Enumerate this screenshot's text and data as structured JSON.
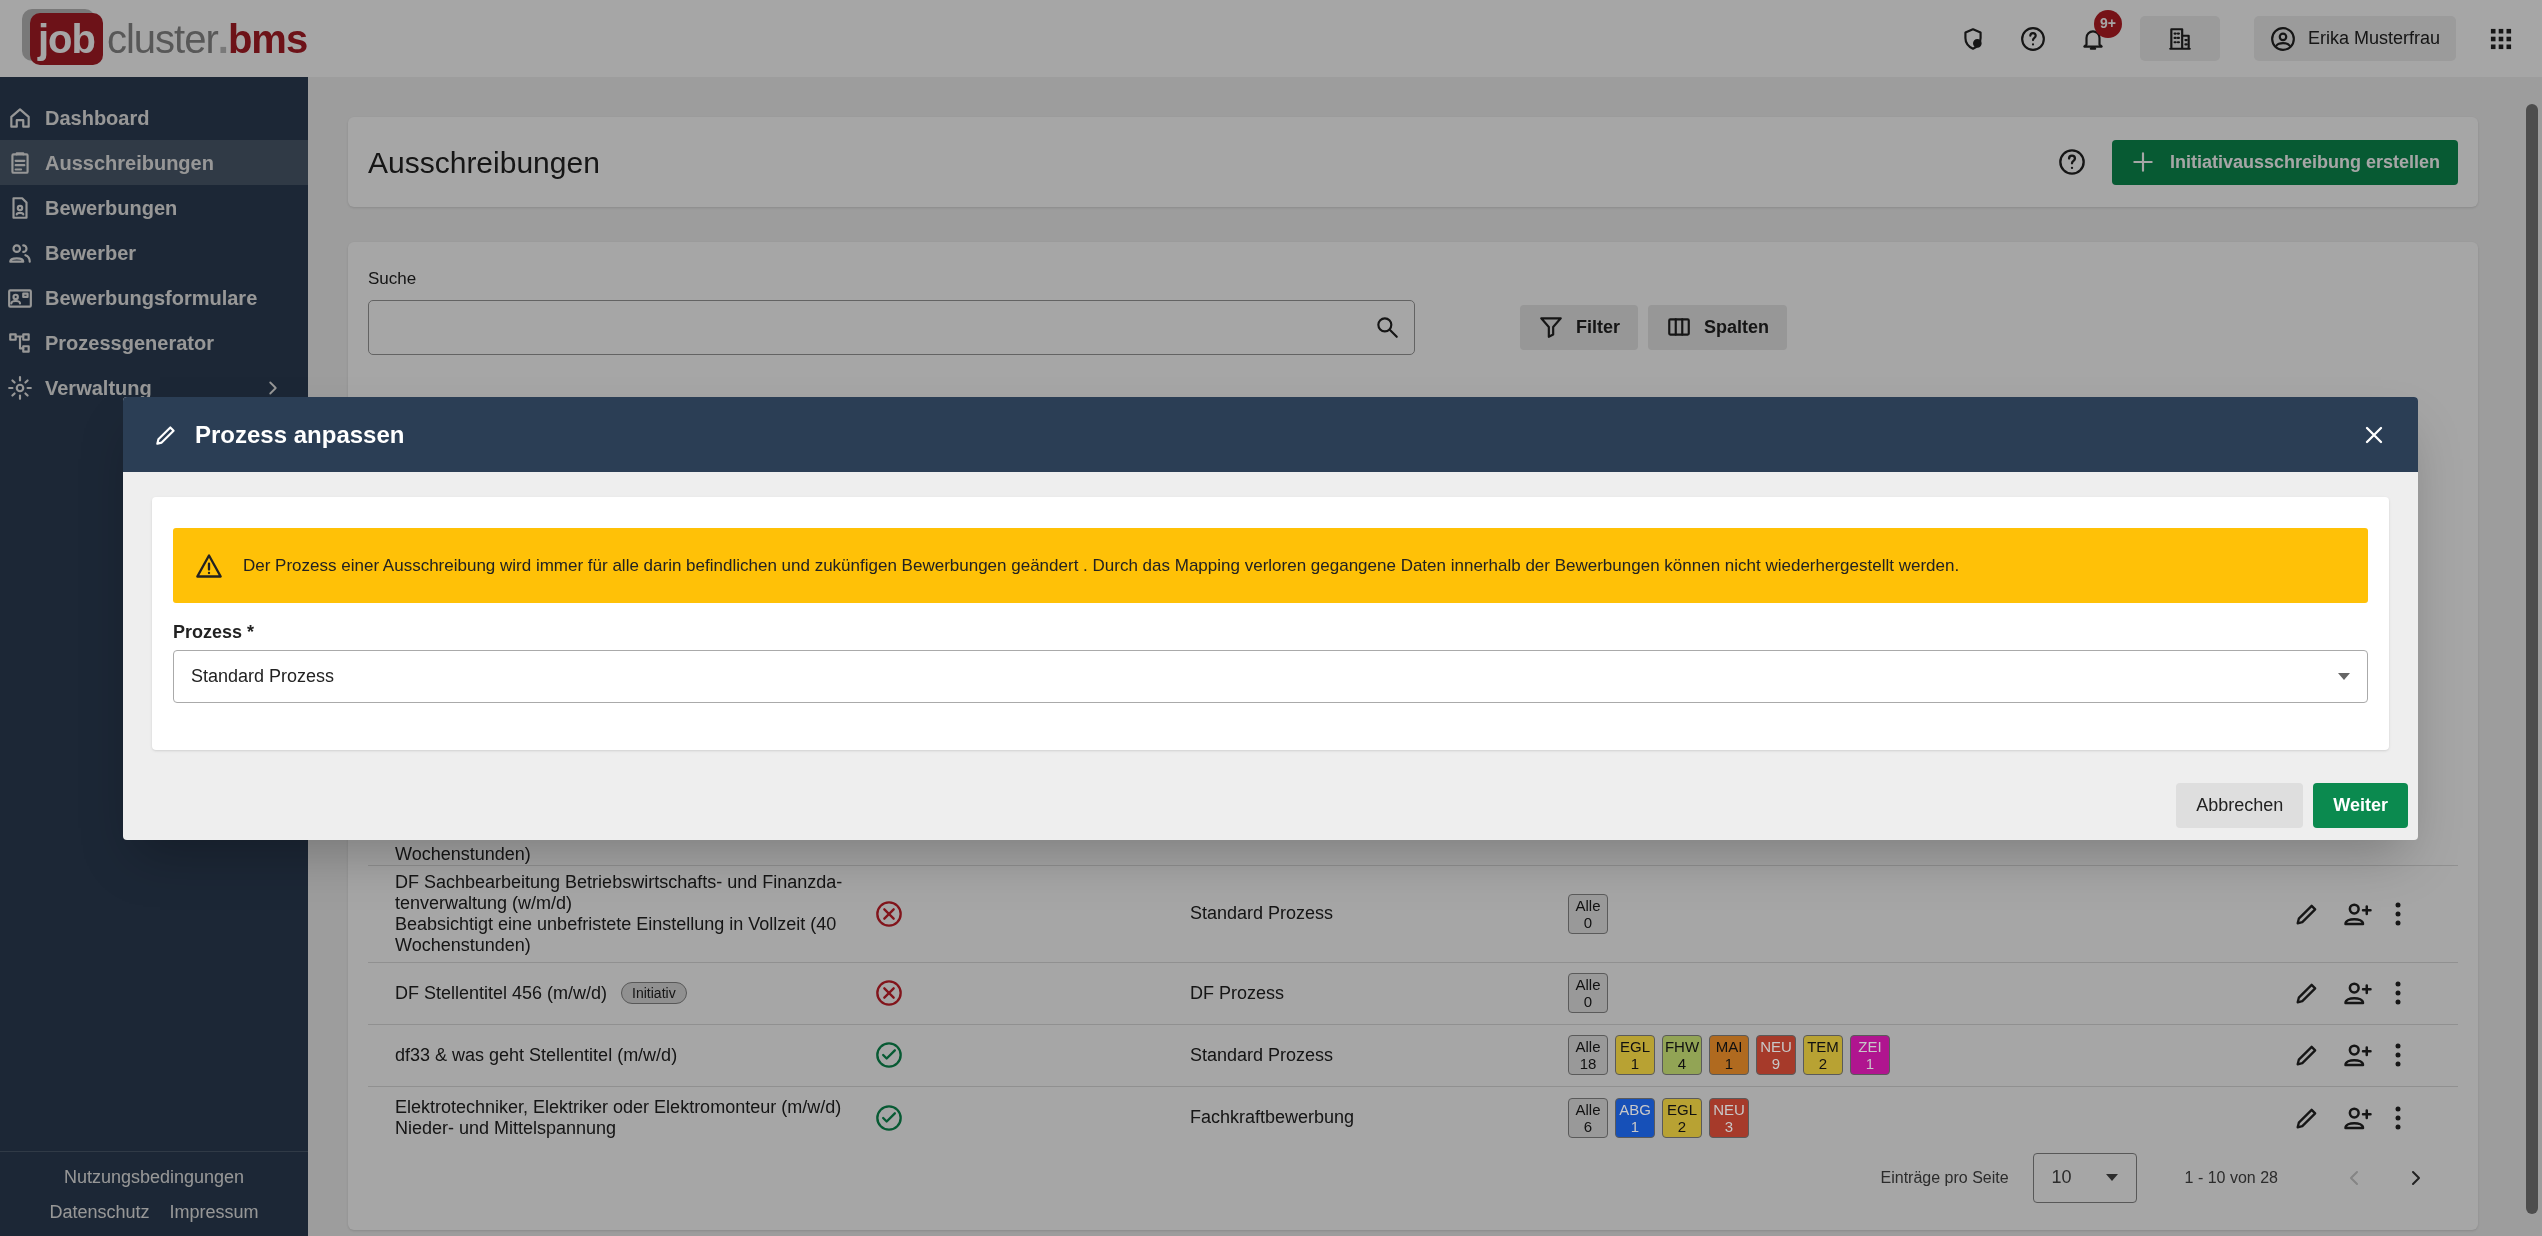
{
  "header": {
    "logo": {
      "badge": "job",
      "main": "cluster",
      "dot": ".",
      "suffix": "bms"
    },
    "notifications_badge": "9+",
    "user_name": "Erika Musterfrau"
  },
  "sidebar": {
    "items": [
      {
        "label": "Dashboard",
        "selected": false,
        "has_submenu": false
      },
      {
        "label": "Ausschreibungen",
        "selected": true,
        "has_submenu": false
      },
      {
        "label": "Bewerbungen",
        "selected": false,
        "has_submenu": false
      },
      {
        "label": "Bewerber",
        "selected": false,
        "has_submenu": false
      },
      {
        "label": "Bewerbungsformulare",
        "selected": false,
        "has_submenu": false
      },
      {
        "label": "Prozessgenerator",
        "selected": false,
        "has_submenu": false
      },
      {
        "label": "Verwaltung",
        "selected": false,
        "has_submenu": true
      }
    ],
    "footer_links": [
      "Nutzungsbedingungen",
      "Datenschutz",
      "Impressum"
    ]
  },
  "page": {
    "title": "Ausschreibungen",
    "create_button": "Initiativausschreibung erstellen",
    "search_label": "Suche",
    "filter_button": "Filter",
    "columns_button": "Spalten"
  },
  "table": {
    "rows": [
      {
        "title_lines": [
          "Wochenstunden)"
        ],
        "partial": true
      },
      {
        "title_lines": [
          "DF Sachbearbeitung Betriebswirtschafts- und Finanzda-",
          "tenverwaltung (w/m/d)",
          "Beabsichtigt eine unbefristete Einstellung in Vollzeit (40",
          "Wochenstunden)"
        ],
        "partial": false,
        "badge": "",
        "active": false,
        "process": "Standard Prozess",
        "chips": [
          {
            "label": "Alle",
            "count": "0",
            "color": "#999999"
          }
        ]
      },
      {
        "title_lines": [
          "DF Stellentitel 456 (m/w/d)"
        ],
        "partial": false,
        "badge": "Initiativ",
        "active": false,
        "process": "DF Prozess",
        "chips": [
          {
            "label": "Alle",
            "count": "0",
            "color": "#999999"
          }
        ]
      },
      {
        "title_lines": [
          "df33 & was geht Stellentitel (m/w/d)"
        ],
        "partial": false,
        "badge": "",
        "active": true,
        "process": "Standard Prozess",
        "chips": [
          {
            "label": "Alle",
            "count": "18",
            "color": "#999999"
          },
          {
            "label": "EGL",
            "count": "1",
            "color": "#b8a233"
          },
          {
            "label": "FHW",
            "count": "4",
            "color": "#92a455"
          },
          {
            "label": "MAI",
            "count": "1",
            "color": "#b06a1f"
          },
          {
            "label": "NEU",
            "count": "9",
            "color": "#a63a2a"
          },
          {
            "label": "TEM",
            "count": "2",
            "color": "#b8a233"
          },
          {
            "label": "ZEI",
            "count": "1",
            "color": "#b0158f"
          }
        ]
      },
      {
        "title_lines": [
          "Elektrotechniker, Elektriker oder Elektromonteur (m/w/d)",
          "Nieder- und Mittelspannung"
        ],
        "partial": false,
        "badge": "",
        "active": true,
        "process": "Fachkraftbewerbung",
        "chips": [
          {
            "label": "Alle",
            "count": "6",
            "color": "#999999"
          },
          {
            "label": "ABG",
            "count": "1",
            "color": "#1650b8"
          },
          {
            "label": "EGL",
            "count": "2",
            "color": "#b8a233"
          },
          {
            "label": "NEU",
            "count": "3",
            "color": "#a63a2a"
          }
        ]
      }
    ]
  },
  "pagination": {
    "label": "Einträge pro Seite",
    "page_size": "10",
    "range": "1 - 10 von 28",
    "prev_disabled": true,
    "next_disabled": false
  },
  "modal": {
    "title": "Prozess anpassen",
    "warning": "Der Prozess einer Ausschreibung wird immer für alle darin befindlichen und zukünfigen Bewerbungen geändert . Durch das Mapping verloren gegangene Daten innerhalb der Bewerbungen können nicht wiederhergestellt werden.",
    "field_label": "Prozess *",
    "field_value": "Standard Prozess",
    "cancel_button": "Abbrechen",
    "confirm_button": "Weiter"
  }
}
